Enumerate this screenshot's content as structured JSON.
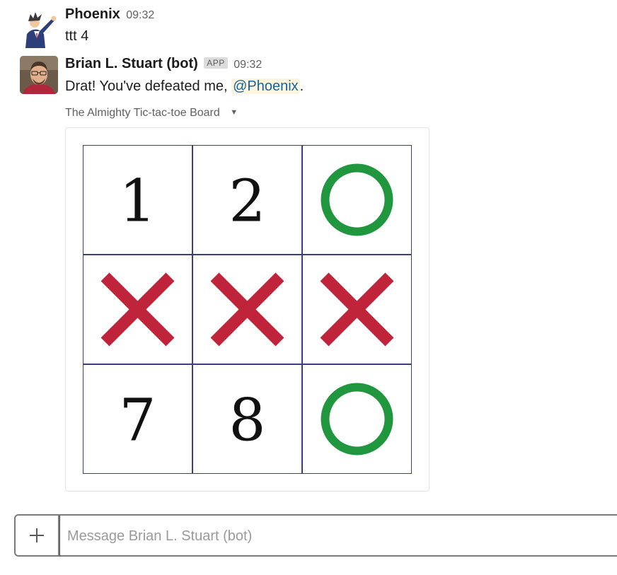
{
  "messages": [
    {
      "sender": "Phoenix",
      "time": "09:32",
      "text": "ttt 4",
      "avatar_icon": "lawyer-pointing-avatar-icon"
    },
    {
      "sender": "Brian L. Stuart (bot)",
      "badge": "APP",
      "time": "09:32",
      "text_before": "Drat! You've defeated me, ",
      "mention": "@Phoenix",
      "text_after": ".",
      "avatar_icon": "bot-profile-photo-icon",
      "attachment": {
        "title": "The Almighty Tic-tac-toe Board",
        "toggle_icon": "caret-down-icon",
        "board": {
          "cells": [
            "1",
            "2",
            "O",
            "X",
            "X",
            "X",
            "7",
            "8",
            "O"
          ],
          "x_color": "#c0243a",
          "o_color": "#20973f",
          "line_color": "#3b3f7a"
        }
      }
    }
  ],
  "composer": {
    "plus_icon": "plus-icon",
    "placeholder": "Message Brian L. Stuart (bot)"
  }
}
